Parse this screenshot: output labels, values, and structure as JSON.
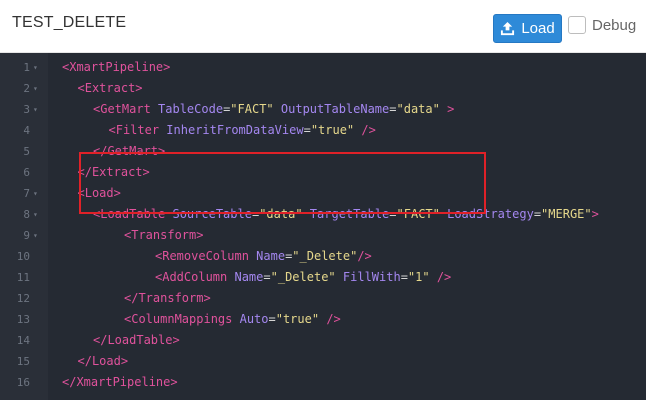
{
  "header": {
    "title": "TEST_DELETE",
    "load_label": "Load",
    "debug_label": "Debug",
    "accent_color": "#2e8ad8"
  },
  "editor": {
    "lines": [
      {
        "n": "1",
        "fold": true,
        "indent": 0,
        "parts": [
          [
            "tag",
            "<XmartPipeline>"
          ]
        ]
      },
      {
        "n": "2",
        "fold": true,
        "indent": 1,
        "parts": [
          [
            "tag",
            "<Extract>"
          ]
        ]
      },
      {
        "n": "3",
        "fold": true,
        "indent": 2,
        "parts": [
          [
            "tag",
            "<GetMart "
          ],
          [
            "attr",
            "TableCode"
          ],
          [
            "txt",
            "="
          ],
          [
            "str",
            "\"FACT\""
          ],
          [
            "txt",
            " "
          ],
          [
            "attr",
            "OutputTableName"
          ],
          [
            "txt",
            "="
          ],
          [
            "str",
            "\"data\""
          ],
          [
            "tag",
            " >"
          ]
        ]
      },
      {
        "n": "4",
        "fold": false,
        "indent": 3,
        "parts": [
          [
            "tag",
            "<Filter "
          ],
          [
            "attr",
            "InheritFromDataView"
          ],
          [
            "txt",
            "="
          ],
          [
            "str",
            "\"true\""
          ],
          [
            "tag",
            " />"
          ]
        ]
      },
      {
        "n": "5",
        "fold": false,
        "indent": 2,
        "parts": [
          [
            "tag",
            "</GetMart>"
          ]
        ]
      },
      {
        "n": "6",
        "fold": false,
        "indent": 1,
        "parts": [
          [
            "tag",
            "</Extract>"
          ]
        ]
      },
      {
        "n": "7",
        "fold": true,
        "indent": 1,
        "parts": [
          [
            "tag",
            "<Load>"
          ]
        ]
      },
      {
        "n": "8",
        "fold": true,
        "indent": 2,
        "parts": [
          [
            "tag",
            "<LoadTable "
          ],
          [
            "attr",
            "SourceTable"
          ],
          [
            "txt",
            "="
          ],
          [
            "str",
            "\"data\""
          ],
          [
            "txt",
            " "
          ],
          [
            "attr",
            "TargetTable"
          ],
          [
            "txt",
            "="
          ],
          [
            "str",
            "\"FACT\""
          ],
          [
            "txt",
            " "
          ],
          [
            "attr",
            "LoadStrategy"
          ],
          [
            "txt",
            "="
          ],
          [
            "str",
            "\"MERGE\""
          ],
          [
            "tag",
            ">"
          ]
        ]
      },
      {
        "n": "9",
        "fold": true,
        "indent": 4,
        "parts": [
          [
            "tag",
            "<Transform>"
          ]
        ]
      },
      {
        "n": "10",
        "fold": false,
        "indent": 6,
        "parts": [
          [
            "tag",
            "<RemoveColumn "
          ],
          [
            "attr",
            "Name"
          ],
          [
            "txt",
            "="
          ],
          [
            "str",
            "\"_Delete\""
          ],
          [
            "tag",
            "/>"
          ]
        ]
      },
      {
        "n": "11",
        "fold": false,
        "indent": 6,
        "parts": [
          [
            "tag",
            "<AddColumn "
          ],
          [
            "attr",
            "Name"
          ],
          [
            "txt",
            "="
          ],
          [
            "str",
            "\"_Delete\""
          ],
          [
            "txt",
            " "
          ],
          [
            "attr",
            "FillWith"
          ],
          [
            "txt",
            "="
          ],
          [
            "str",
            "\"1\""
          ],
          [
            "tag",
            " />"
          ]
        ]
      },
      {
        "n": "12",
        "fold": false,
        "indent": 4,
        "parts": [
          [
            "tag",
            "</Transform>"
          ]
        ]
      },
      {
        "n": "13",
        "fold": false,
        "indent": 4,
        "parts": [
          [
            "tag",
            "<ColumnMappings "
          ],
          [
            "attr",
            "Auto"
          ],
          [
            "txt",
            "="
          ],
          [
            "str",
            "\"true\""
          ],
          [
            "tag",
            " />"
          ]
        ]
      },
      {
        "n": "14",
        "fold": false,
        "indent": 2,
        "parts": [
          [
            "tag",
            "</LoadTable>"
          ]
        ]
      },
      {
        "n": "15",
        "fold": false,
        "indent": 1,
        "parts": [
          [
            "tag",
            "</Load>"
          ]
        ]
      },
      {
        "n": "16",
        "fold": false,
        "indent": 0,
        "parts": [
          [
            "tag",
            "</XmartPipeline>"
          ]
        ]
      }
    ],
    "highlight_color": "#e02128"
  }
}
